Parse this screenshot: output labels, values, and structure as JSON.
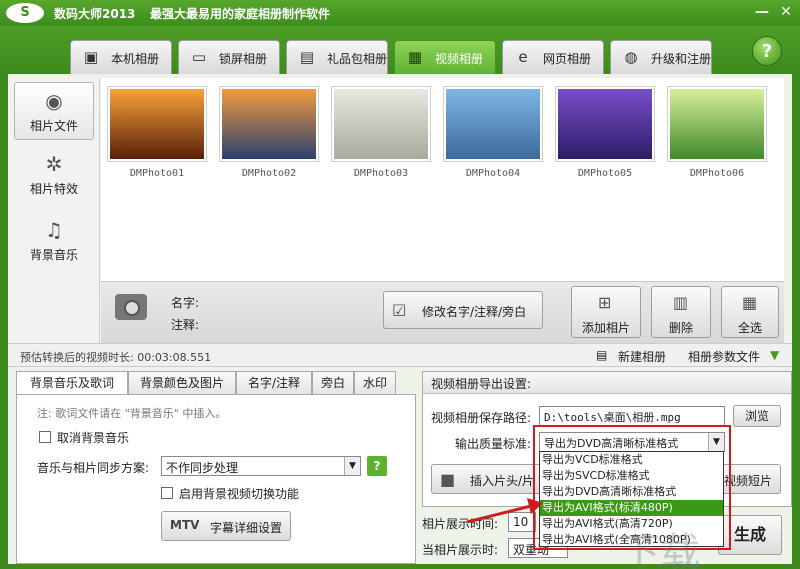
{
  "window": {
    "logo": "S",
    "title": "数码大师2013",
    "slogan": "最强大最易用的家庭相册制作软件",
    "min": "—",
    "close": "✕"
  },
  "tabs": [
    {
      "label": "本机相册",
      "icon": "person-frame-icon"
    },
    {
      "label": "锁屏相册",
      "icon": "monitor-icon"
    },
    {
      "label": "礼品包相册",
      "icon": "gift-icon"
    },
    {
      "label": "视频相册",
      "icon": "film-icon"
    },
    {
      "label": "网页相册",
      "icon": "ie-icon"
    },
    {
      "label": "升级和注册",
      "icon": "globe-icon"
    }
  ],
  "help": "?",
  "sidebar": [
    {
      "label": "相片文件",
      "icon": "camera-icon"
    },
    {
      "label": "相片特效",
      "icon": "sparkle-icon"
    },
    {
      "label": "背景音乐",
      "icon": "music-note-icon"
    }
  ],
  "photos": [
    {
      "caption": "DMPhoto01",
      "colors": [
        "#f7a23a",
        "#5a1f0a"
      ]
    },
    {
      "caption": "DMPhoto02",
      "colors": [
        "#f29b3c",
        "#2c3f73"
      ]
    },
    {
      "caption": "DMPhoto03",
      "colors": [
        "#e8e8e2",
        "#a9a89c"
      ]
    },
    {
      "caption": "DMPhoto04",
      "colors": [
        "#7fb5e6",
        "#3b6b9a"
      ]
    },
    {
      "caption": "DMPhoto05",
      "colors": [
        "#7a4fc9",
        "#2a1d66"
      ]
    },
    {
      "caption": "DMPhoto06",
      "colors": [
        "#d8ef9a",
        "#3f8a2a"
      ]
    }
  ],
  "info": {
    "name_label": "名字:",
    "note_label": "注释:",
    "edit_button": "修改名字/注释/旁白"
  },
  "actions": {
    "add": "添加相片",
    "delete": "删除",
    "select_all": "全选"
  },
  "status": {
    "duration": "预估转换后的视频时长: 00:03:08.551",
    "new_album": "新建相册",
    "params": "相册参数文件"
  },
  "subtabs": [
    "背景音乐及歌词",
    "背景颜色及图片",
    "名字/注释",
    "旁白",
    "水印"
  ],
  "music_panel": {
    "hint": "注: 歌词文件请在 \"背景音乐\" 中插入。",
    "cancel_music": "取消背景音乐",
    "sync_label": "音乐与相片同步方案:",
    "sync_value": "不作同步处理",
    "bg_video": "启用背景视频切换功能",
    "mtv_logo": "MTV",
    "mtv_button": "字幕详细设置"
  },
  "export": {
    "title": "视频相册导出设置:",
    "path_label": "视频相册保存路径:",
    "path_value": "D:\\tools\\桌面\\相册.mpg",
    "browse": "浏览",
    "quality_label": "输出质量标准:",
    "quality_value": "导出为DVD高清晰标准格式",
    "insert_button": "插入片头/片",
    "short_video": "视频短片",
    "display_time_label": "相片展示时间:",
    "display_time_value": "10",
    "when_label": "当相片展示时:",
    "when_value": "双重动",
    "generate": "生成"
  },
  "dropdown_options": [
    "导出为VCD标准格式",
    "导出为SVCD标准格式",
    "导出为DVD高清晰标准格式",
    "导出为AVI格式(标清480P)",
    "导出为AVI格式(高清720P)",
    "导出为AVI格式(全高清1080P)"
  ],
  "dropdown_highlight_index": 3,
  "watermark": "下载"
}
